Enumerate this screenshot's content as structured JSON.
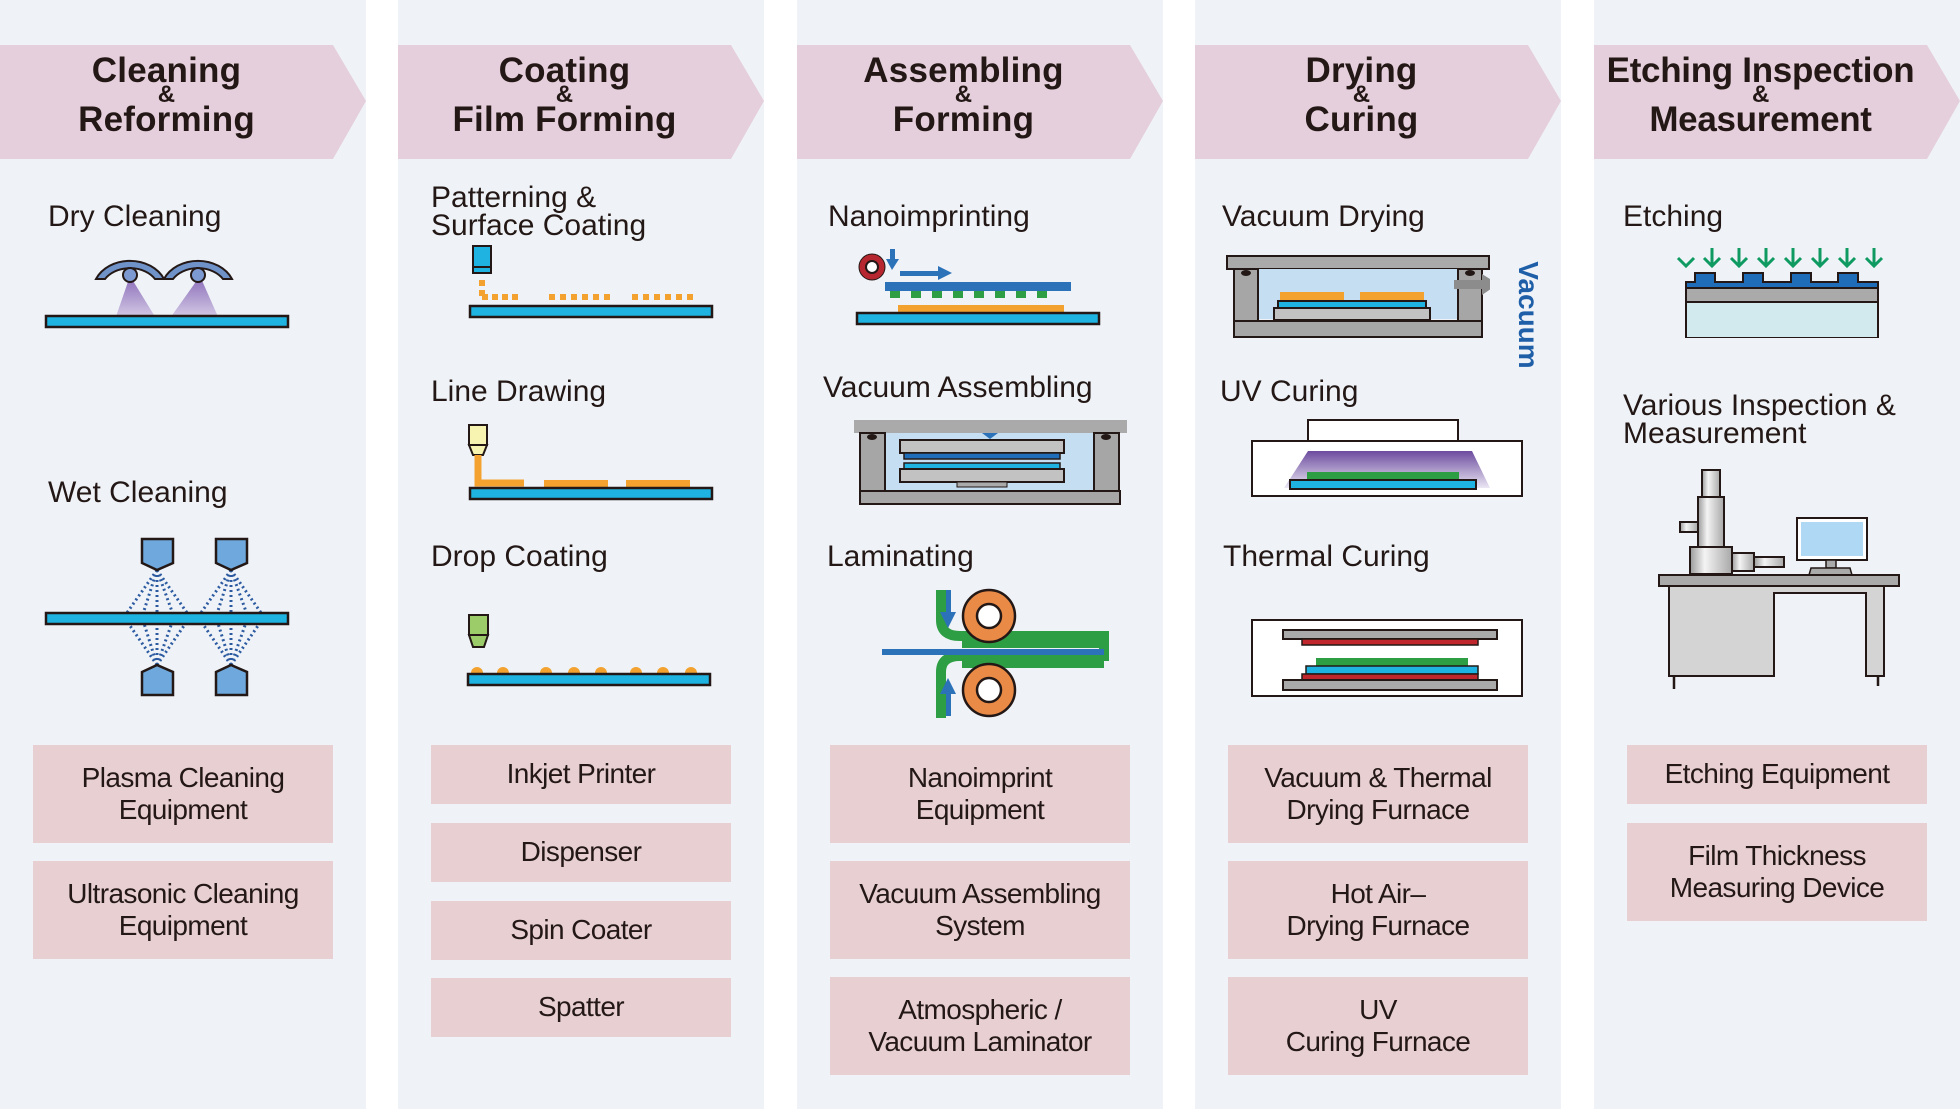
{
  "colors": {
    "column_bg": "#eff3f8",
    "header_bg": "#e5cfdc",
    "equipment_bg": "#e7cfd2",
    "text": "#231815",
    "substrate": "#1eb3e0",
    "accent_orange": "#f3a22f",
    "accent_green": "#2e9e44",
    "accent_blue": "#2c72b9",
    "vacuum_label": "#1f5fa8"
  },
  "columns": [
    {
      "title": [
        "Cleaning",
        "&",
        "Reforming"
      ],
      "processes": [
        {
          "label": [
            "Dry Cleaning"
          ],
          "icon": "dry-cleaning-illustration"
        },
        {
          "label": [
            "Wet Cleaning"
          ],
          "icon": "wet-cleaning-illustration"
        }
      ],
      "equipment": [
        [
          "Plasma Cleaning",
          "Equipment"
        ],
        [
          "Ultrasonic Cleaning",
          "Equipment"
        ]
      ]
    },
    {
      "title": [
        "Coating",
        "&",
        "Film Forming"
      ],
      "processes": [
        {
          "label": [
            "Patterning &",
            "Surface Coating"
          ],
          "icon": "patterning-illustration"
        },
        {
          "label": [
            "Line Drawing"
          ],
          "icon": "line-drawing-illustration"
        },
        {
          "label": [
            "Drop Coating"
          ],
          "icon": "drop-coating-illustration"
        }
      ],
      "equipment": [
        [
          "Inkjet Printer"
        ],
        [
          "Dispenser"
        ],
        [
          "Spin Coater"
        ],
        [
          "Spatter"
        ]
      ]
    },
    {
      "title": [
        "Assembling",
        "&",
        "Forming"
      ],
      "processes": [
        {
          "label": [
            "Nanoimprinting"
          ],
          "icon": "nanoimprint-illustration"
        },
        {
          "label": [
            "Vacuum Assembling"
          ],
          "icon": "vacuum-assembling-illustration"
        },
        {
          "label": [
            "Laminating"
          ],
          "icon": "laminating-illustration"
        }
      ],
      "equipment": [
        [
          "Nanoimprint",
          "Equipment"
        ],
        [
          "Vacuum Assembling",
          "System"
        ],
        [
          "Atmospheric /",
          "Vacuum Laminator"
        ]
      ]
    },
    {
      "title": [
        "Drying",
        "&",
        "Curing"
      ],
      "processes": [
        {
          "label": [
            "Vacuum Drying"
          ],
          "icon": "vacuum-drying-illustration",
          "side_label": "Vacuum"
        },
        {
          "label": [
            "UV Curing"
          ],
          "icon": "uv-curing-illustration"
        },
        {
          "label": [
            "Thermal Curing"
          ],
          "icon": "thermal-curing-illustration"
        }
      ],
      "equipment": [
        [
          "Vacuum & Thermal",
          "Drying Furnace"
        ],
        [
          "Hot Air–",
          "Drying Furnace"
        ],
        [
          "UV",
          "Curing Furnace"
        ]
      ]
    },
    {
      "title": [
        "Etching Inspection",
        "&",
        "Measurement"
      ],
      "processes": [
        {
          "label": [
            "Etching"
          ],
          "icon": "etching-illustration"
        },
        {
          "label": [
            "Various Inspection &",
            "Measurement"
          ],
          "icon": "inspection-station-illustration"
        }
      ],
      "equipment": [
        [
          "Etching Equipment"
        ],
        [
          "Film Thickness",
          "Measuring Device"
        ]
      ]
    }
  ]
}
